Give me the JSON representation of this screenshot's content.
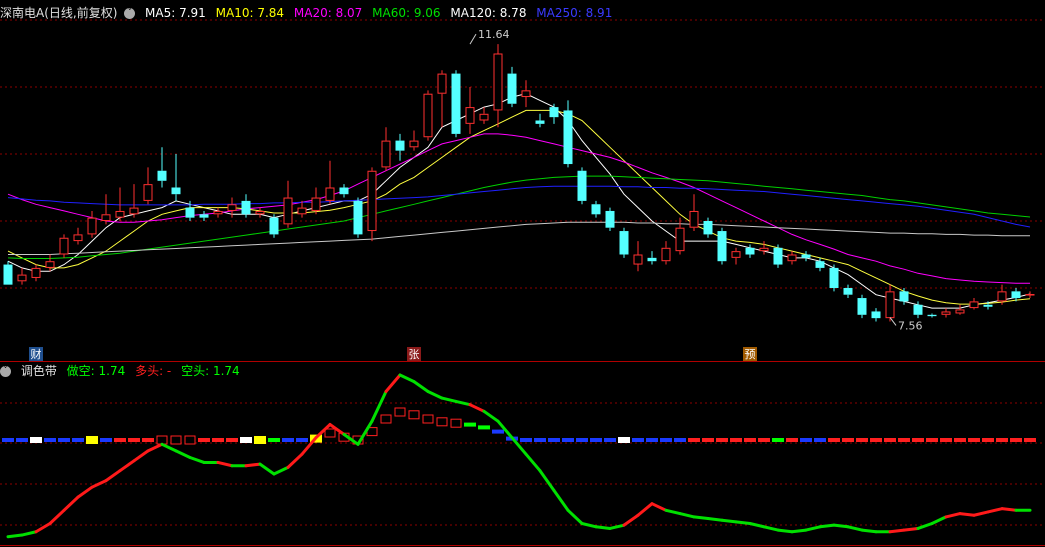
{
  "header": {
    "title": "深南电A(日线,前复权)",
    "ma": [
      {
        "label": "MA5: 7.91",
        "color": "#ffffff"
      },
      {
        "label": "MA10: 7.84",
        "color": "#ffff00"
      },
      {
        "label": "MA20: 8.07",
        "color": "#ff00ff"
      },
      {
        "label": "MA60: 9.06",
        "color": "#00e000"
      },
      {
        "label": "MA120: 8.78",
        "color": "#ffffff"
      },
      {
        "label": "MA250: 8.91",
        "color": "#3a3aff"
      }
    ]
  },
  "sub_header": {
    "title": "调色带",
    "items": [
      {
        "label": "做空: 1.74",
        "color": "#00ff00"
      },
      {
        "label": "多头: -",
        "color": "#ff2020"
      },
      {
        "label": "空头: 1.74",
        "color": "#00ff00"
      }
    ]
  },
  "colors": {
    "up": "#ff3030",
    "down": "#54ffff",
    "grid": "#8b0000",
    "ma5": "#ffffff",
    "ma10": "#ffff40",
    "ma20": "#ff00ff",
    "ma60": "#00d000",
    "ma120": "#c8c8c8",
    "ma250": "#2020ff"
  },
  "chart_data": [
    {
      "type": "candlestick",
      "title": "深南电A(日线,前复权)",
      "price_range": [
        7.0,
        12.0
      ],
      "annotations": [
        {
          "label": "11.64",
          "value": 11.64,
          "at_index": 33
        },
        {
          "label": "7.56",
          "value": 7.56,
          "at_index": 63
        }
      ],
      "event_markers": [
        {
          "label": "财",
          "at_index": 2,
          "bg": "#1f4f8f",
          "fg": "#ffffff"
        },
        {
          "label": "张",
          "at_index": 29,
          "bg": "#8b1a1a",
          "fg": "#ffffff"
        },
        {
          "label": "预",
          "at_index": 53,
          "bg": "#a05a00",
          "fg": "#ffffff"
        }
      ],
      "candles": [
        [
          8.35,
          8.05,
          8.4,
          8.05
        ],
        [
          8.1,
          8.2,
          8.3,
          8.05
        ],
        [
          8.15,
          8.3,
          8.35,
          8.1
        ],
        [
          8.3,
          8.4,
          8.5,
          8.25
        ],
        [
          8.5,
          8.75,
          8.8,
          8.45
        ],
        [
          8.7,
          8.8,
          8.9,
          8.65
        ],
        [
          8.8,
          9.05,
          9.15,
          8.75
        ],
        [
          9.0,
          9.1,
          9.4,
          8.95
        ],
        [
          9.05,
          9.15,
          9.5,
          9.0
        ],
        [
          9.1,
          9.2,
          9.55,
          9.05
        ],
        [
          9.3,
          9.55,
          9.8,
          9.25
        ],
        [
          9.75,
          9.6,
          10.1,
          9.5
        ],
        [
          9.5,
          9.4,
          10.0,
          9.3
        ],
        [
          9.2,
          9.05,
          9.3,
          9.0
        ],
        [
          9.1,
          9.05,
          9.15,
          9.0
        ],
        [
          9.1,
          9.15,
          9.2,
          9.05
        ],
        [
          9.15,
          9.25,
          9.35,
          9.05
        ],
        [
          9.3,
          9.1,
          9.4,
          9.05
        ],
        [
          9.1,
          9.15,
          9.2,
          9.05
        ],
        [
          9.05,
          8.8,
          9.1,
          8.75
        ],
        [
          8.95,
          9.35,
          9.6,
          8.9
        ],
        [
          9.1,
          9.2,
          9.3,
          9.05
        ],
        [
          9.15,
          9.35,
          9.5,
          9.1
        ],
        [
          9.3,
          9.5,
          9.9,
          9.25
        ],
        [
          9.5,
          9.4,
          9.55,
          9.35
        ],
        [
          9.3,
          8.8,
          9.35,
          8.75
        ],
        [
          8.85,
          9.75,
          9.8,
          8.7
        ],
        [
          9.8,
          10.2,
          10.4,
          9.75
        ],
        [
          10.2,
          10.05,
          10.3,
          9.9
        ],
        [
          10.1,
          10.2,
          10.35,
          10.05
        ],
        [
          10.25,
          10.9,
          10.95,
          10.2
        ],
        [
          10.9,
          11.2,
          11.25,
          10.4
        ],
        [
          11.2,
          10.3,
          11.25,
          10.25
        ],
        [
          10.45,
          10.7,
          11.0,
          10.3
        ],
        [
          10.5,
          10.6,
          10.7,
          10.45
        ],
        [
          10.65,
          11.5,
          11.64,
          10.4
        ],
        [
          11.2,
          10.75,
          11.3,
          10.7
        ],
        [
          10.85,
          10.95,
          11.1,
          10.7
        ],
        [
          10.5,
          10.45,
          10.6,
          10.4
        ],
        [
          10.7,
          10.55,
          10.75,
          10.45
        ],
        [
          10.65,
          9.85,
          10.8,
          9.8
        ],
        [
          9.75,
          9.3,
          9.8,
          9.25
        ],
        [
          9.25,
          9.1,
          9.3,
          9.05
        ],
        [
          9.15,
          8.9,
          9.2,
          8.85
        ],
        [
          8.85,
          8.5,
          8.9,
          8.45
        ],
        [
          8.35,
          8.5,
          8.7,
          8.25
        ],
        [
          8.45,
          8.4,
          8.55,
          8.35
        ],
        [
          8.4,
          8.6,
          8.7,
          8.35
        ],
        [
          8.55,
          8.9,
          9.05,
          8.5
        ],
        [
          8.9,
          9.15,
          9.4,
          8.85
        ],
        [
          9.0,
          8.8,
          9.05,
          8.75
        ],
        [
          8.85,
          8.4,
          8.9,
          8.35
        ],
        [
          8.45,
          8.55,
          8.6,
          8.35
        ],
        [
          8.6,
          8.5,
          8.65,
          8.45
        ],
        [
          8.55,
          8.6,
          8.7,
          8.5
        ],
        [
          8.6,
          8.35,
          8.65,
          8.3
        ],
        [
          8.4,
          8.5,
          8.55,
          8.35
        ],
        [
          8.5,
          8.45,
          8.55,
          8.4
        ],
        [
          8.4,
          8.3,
          8.45,
          8.25
        ],
        [
          8.3,
          8.0,
          8.35,
          7.95
        ],
        [
          8.0,
          7.9,
          8.05,
          7.85
        ],
        [
          7.85,
          7.6,
          7.9,
          7.55
        ],
        [
          7.65,
          7.55,
          7.7,
          7.5
        ],
        [
          7.55,
          7.95,
          8.05,
          7.5
        ],
        [
          7.95,
          7.8,
          8.0,
          7.75
        ],
        [
          7.75,
          7.6,
          7.8,
          7.55
        ],
        [
          7.6,
          7.58,
          7.62,
          7.56
        ],
        [
          7.6,
          7.65,
          7.7,
          7.56
        ],
        [
          7.62,
          7.68,
          7.75,
          7.6
        ],
        [
          7.7,
          7.8,
          7.85,
          7.68
        ],
        [
          7.75,
          7.72,
          7.8,
          7.68
        ],
        [
          7.8,
          7.95,
          8.05,
          7.75
        ],
        [
          7.95,
          7.85,
          8.0,
          7.8
        ],
        [
          7.9,
          7.91,
          7.95,
          7.85
        ]
      ],
      "ma_lines": [
        {
          "name": "MA5",
          "values": [
            8.4,
            8.3,
            8.25,
            8.25,
            8.35,
            8.5,
            8.7,
            8.9,
            9.05,
            9.1,
            9.15,
            9.2,
            9.3,
            9.25,
            9.2,
            9.15,
            9.1,
            9.1,
            9.1,
            9.05,
            9.1,
            9.15,
            9.2,
            9.25,
            9.3,
            9.3,
            9.4,
            9.6,
            9.8,
            9.95,
            10.1,
            10.4,
            10.5,
            10.6,
            10.7,
            10.75,
            10.85,
            10.9,
            10.8,
            10.7,
            10.5,
            10.2,
            9.95,
            9.7,
            9.4,
            9.2,
            9.0,
            8.85,
            8.7,
            8.7,
            8.7,
            8.7,
            8.65,
            8.6,
            8.55,
            8.5,
            8.45,
            8.45,
            8.4,
            8.3,
            8.2,
            8.05,
            7.9,
            7.85,
            7.8,
            7.75,
            7.7,
            7.7,
            7.7,
            7.75,
            7.78,
            7.82,
            7.86,
            7.91
          ]
        },
        {
          "name": "MA10",
          "values": [
            8.55,
            8.45,
            8.35,
            8.3,
            8.3,
            8.35,
            8.45,
            8.55,
            8.7,
            8.85,
            9.0,
            9.1,
            9.15,
            9.2,
            9.2,
            9.2,
            9.2,
            9.18,
            9.15,
            9.12,
            9.12,
            9.12,
            9.14,
            9.16,
            9.2,
            9.25,
            9.3,
            9.4,
            9.55,
            9.65,
            9.8,
            9.95,
            10.1,
            10.25,
            10.35,
            10.45,
            10.55,
            10.65,
            10.65,
            10.65,
            10.6,
            10.5,
            10.3,
            10.1,
            9.9,
            9.7,
            9.5,
            9.3,
            9.1,
            8.95,
            8.85,
            8.75,
            8.7,
            8.68,
            8.65,
            8.6,
            8.55,
            8.5,
            8.45,
            8.4,
            8.35,
            8.25,
            8.15,
            8.05,
            7.95,
            7.88,
            7.82,
            7.78,
            7.76,
            7.76,
            7.77,
            7.79,
            7.82,
            7.84
          ]
        },
        {
          "name": "MA20",
          "values": [
            9.4,
            9.32,
            9.25,
            9.2,
            9.15,
            9.1,
            9.05,
            9.0,
            8.98,
            8.98,
            9.0,
            9.02,
            9.05,
            9.08,
            9.1,
            9.12,
            9.15,
            9.18,
            9.2,
            9.22,
            9.24,
            9.28,
            9.32,
            9.38,
            9.45,
            9.55,
            9.65,
            9.75,
            9.85,
            9.95,
            10.05,
            10.15,
            10.2,
            10.25,
            10.3,
            10.3,
            10.28,
            10.25,
            10.2,
            10.15,
            10.1,
            10.05,
            10.0,
            9.95,
            9.88,
            9.8,
            9.72,
            9.65,
            9.58,
            9.5,
            9.4,
            9.3,
            9.2,
            9.1,
            9.0,
            8.9,
            8.8,
            8.72,
            8.65,
            8.58,
            8.5,
            8.45,
            8.4,
            8.33,
            8.28,
            8.22,
            8.18,
            8.14,
            8.12,
            8.1,
            8.09,
            8.08,
            8.07,
            8.07
          ]
        },
        {
          "name": "MA60",
          "values": [
            8.45,
            8.44,
            8.44,
            8.44,
            8.45,
            8.46,
            8.48,
            8.5,
            8.52,
            8.55,
            8.58,
            8.61,
            8.64,
            8.67,
            8.7,
            8.73,
            8.76,
            8.79,
            8.82,
            8.85,
            8.88,
            8.91,
            8.94,
            8.97,
            9.0,
            9.05,
            9.1,
            9.15,
            9.2,
            9.25,
            9.3,
            9.35,
            9.4,
            9.45,
            9.5,
            9.54,
            9.58,
            9.61,
            9.63,
            9.65,
            9.66,
            9.67,
            9.67,
            9.67,
            9.66,
            9.65,
            9.64,
            9.63,
            9.62,
            9.61,
            9.6,
            9.58,
            9.56,
            9.54,
            9.52,
            9.5,
            9.48,
            9.46,
            9.44,
            9.42,
            9.4,
            9.38,
            9.35,
            9.32,
            9.3,
            9.27,
            9.24,
            9.21,
            9.18,
            9.15,
            9.12,
            9.1,
            9.08,
            9.06
          ]
        },
        {
          "name": "MA120",
          "values": [
            8.5,
            8.5,
            8.5,
            8.5,
            8.51,
            8.52,
            8.53,
            8.54,
            8.55,
            8.56,
            8.57,
            8.58,
            8.59,
            8.6,
            8.61,
            8.62,
            8.63,
            8.64,
            8.65,
            8.66,
            8.67,
            8.68,
            8.69,
            8.7,
            8.71,
            8.72,
            8.73,
            8.75,
            8.77,
            8.79,
            8.81,
            8.83,
            8.85,
            8.87,
            8.89,
            8.91,
            8.93,
            8.95,
            8.96,
            8.97,
            8.98,
            8.98,
            8.98,
            8.98,
            8.98,
            8.97,
            8.97,
            8.96,
            8.96,
            8.95,
            8.95,
            8.94,
            8.93,
            8.92,
            8.91,
            8.9,
            8.89,
            8.88,
            8.87,
            8.86,
            8.85,
            8.84,
            8.83,
            8.82,
            8.82,
            8.81,
            8.81,
            8.8,
            8.8,
            8.79,
            8.79,
            8.78,
            8.78,
            8.78
          ]
        },
        {
          "name": "MA250",
          "values": [
            9.35,
            9.33,
            9.31,
            9.3,
            9.28,
            9.27,
            9.26,
            9.25,
            9.24,
            9.24,
            9.24,
            9.24,
            9.24,
            9.24,
            9.25,
            9.25,
            9.25,
            9.26,
            9.26,
            9.27,
            9.27,
            9.28,
            9.28,
            9.29,
            9.3,
            9.31,
            9.32,
            9.33,
            9.34,
            9.35,
            9.36,
            9.38,
            9.4,
            9.42,
            9.44,
            9.46,
            9.48,
            9.5,
            9.51,
            9.52,
            9.52,
            9.52,
            9.52,
            9.52,
            9.51,
            9.51,
            9.5,
            9.5,
            9.49,
            9.49,
            9.48,
            9.47,
            9.46,
            9.45,
            9.44,
            9.42,
            9.4,
            9.38,
            9.36,
            9.34,
            9.32,
            9.3,
            9.28,
            9.26,
            9.24,
            9.22,
            9.19,
            9.16,
            9.13,
            9.1,
            9.05,
            9.0,
            8.95,
            8.91
          ]
        }
      ]
    },
    {
      "type": "line",
      "title": "调色带",
      "y_range": [
        0,
        1
      ],
      "line_values": [
        0.02,
        0.03,
        0.05,
        0.1,
        0.18,
        0.26,
        0.32,
        0.36,
        0.42,
        0.48,
        0.54,
        0.58,
        0.54,
        0.5,
        0.47,
        0.47,
        0.45,
        0.45,
        0.46,
        0.4,
        0.44,
        0.52,
        0.62,
        0.7,
        0.64,
        0.58,
        0.72,
        0.9,
        1.0,
        0.96,
        0.9,
        0.86,
        0.84,
        0.82,
        0.78,
        0.72,
        0.62,
        0.52,
        0.42,
        0.3,
        0.18,
        0.1,
        0.08,
        0.07,
        0.09,
        0.15,
        0.22,
        0.18,
        0.16,
        0.14,
        0.13,
        0.12,
        0.11,
        0.1,
        0.08,
        0.06,
        0.05,
        0.06,
        0.08,
        0.09,
        0.08,
        0.06,
        0.05,
        0.05,
        0.06,
        0.07,
        0.1,
        0.14,
        0.16,
        0.15,
        0.17,
        0.19,
        0.18,
        0.18
      ],
      "line_colors": [
        "g",
        "g",
        "r",
        "r",
        "r",
        "r",
        "r",
        "r",
        "r",
        "r",
        "r",
        "g",
        "g",
        "g",
        "g",
        "r",
        "g",
        "r",
        "g",
        "g",
        "r",
        "r",
        "r",
        "r",
        "g",
        "g",
        "g",
        "r",
        "g",
        "g",
        "g",
        "g",
        "g",
        "r",
        "g",
        "g",
        "g",
        "g",
        "g",
        "g",
        "g",
        "g",
        "g",
        "g",
        "r",
        "r",
        "r",
        "g",
        "g",
        "g",
        "g",
        "g",
        "g",
        "g",
        "g",
        "g",
        "g",
        "g",
        "g",
        "g",
        "g",
        "g",
        "g",
        "r",
        "r",
        "g",
        "g",
        "r",
        "r",
        "r",
        "r",
        "r",
        "g",
        "g"
      ],
      "band_kinds": [
        "d",
        "d",
        "w",
        "d",
        "d",
        "d",
        "y",
        "d",
        "r",
        "r",
        "r",
        "u",
        "u",
        "u",
        "r",
        "r",
        "r",
        "w",
        "y",
        "g",
        "d",
        "d",
        "y",
        "u",
        "u",
        "u",
        "u",
        "u",
        "u",
        "u",
        "u",
        "u",
        "u",
        "g",
        "g",
        "d",
        "d",
        "d",
        "d",
        "d",
        "d",
        "d",
        "d",
        "d",
        "w",
        "d",
        "d",
        "d",
        "d",
        "r",
        "r",
        "r",
        "r",
        "r",
        "r",
        "g",
        "r",
        "d",
        "d",
        "r",
        "r",
        "r",
        "r",
        "r",
        "r",
        "r",
        "r",
        "r",
        "r",
        "r",
        "r",
        "r",
        "r",
        "r"
      ]
    }
  ]
}
